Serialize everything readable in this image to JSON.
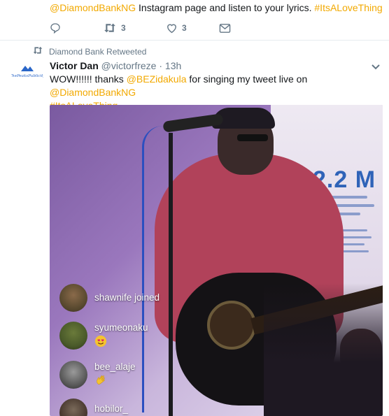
{
  "previous_tweet": {
    "text_mention": "@DiamondBankNG",
    "text_middle": " Instagram page and listen to your lyrics. ",
    "text_hashtag": "#ItsALoveThing",
    "retweet_count": "3",
    "like_count": "3",
    "icons": [
      "reply-icon",
      "retweet-icon",
      "like-icon",
      "direct-message-icon"
    ]
  },
  "tweet": {
    "retweeted_by_label": "Diamond Bank Retweeted",
    "avatar_logo_text": "ThePeaksPublicity",
    "author_name": "Victor Dan",
    "author_handle": "@victorfreze",
    "separator": " · ",
    "timestamp": "13h",
    "body": {
      "part1": "WOW!!!!!! thanks ",
      "mention1": "@BEZidakula",
      "part2": " for singing my tweet live on ",
      "mention2": "@DiamondBankNG",
      "hashtag": "#ItsALoveThing"
    },
    "media": {
      "wall_text": "2.2 M",
      "live_comments": [
        {
          "user": "shawnife",
          "text": "shawnife joined",
          "emoji": ""
        },
        {
          "user": "syumeonaku",
          "text": "syumeonaku",
          "emoji": "heart-eyes-emoji"
        },
        {
          "user": "bee_alaje",
          "text": "bee_alaje",
          "emoji": "waving-hand-emoji"
        },
        {
          "user": "hobilor_",
          "text": "hobilor_",
          "emoji": ""
        }
      ]
    }
  },
  "colors": {
    "link": "#f2a900",
    "muted": "#657786",
    "text": "#14171a",
    "divider": "#e6ecf0"
  }
}
